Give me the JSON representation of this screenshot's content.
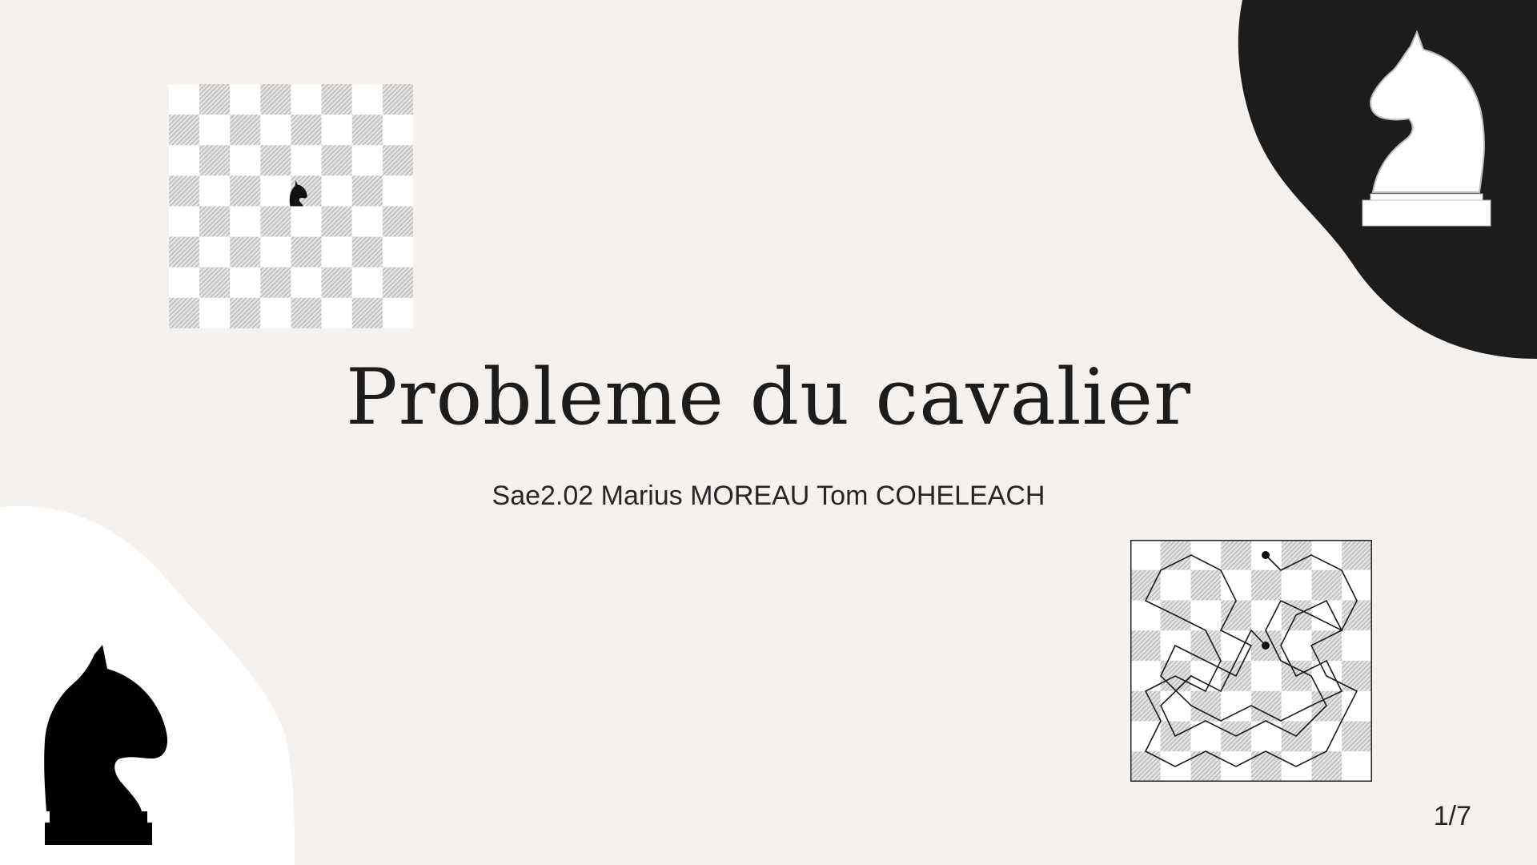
{
  "slide": {
    "title": "Probleme du cavalier",
    "subtitle": "Sae2.02 Marius MOREAU Tom COHELEACH",
    "page_number": "1/7"
  },
  "icons": {
    "top_board_piece": "black-knight-icon",
    "top_right_piece": "white-knight-icon",
    "bottom_left_piece": "black-knight-icon"
  },
  "colors": {
    "background": "#f4f1ee",
    "dark": "#1c1c1c",
    "light_blob": "#ffffff"
  }
}
